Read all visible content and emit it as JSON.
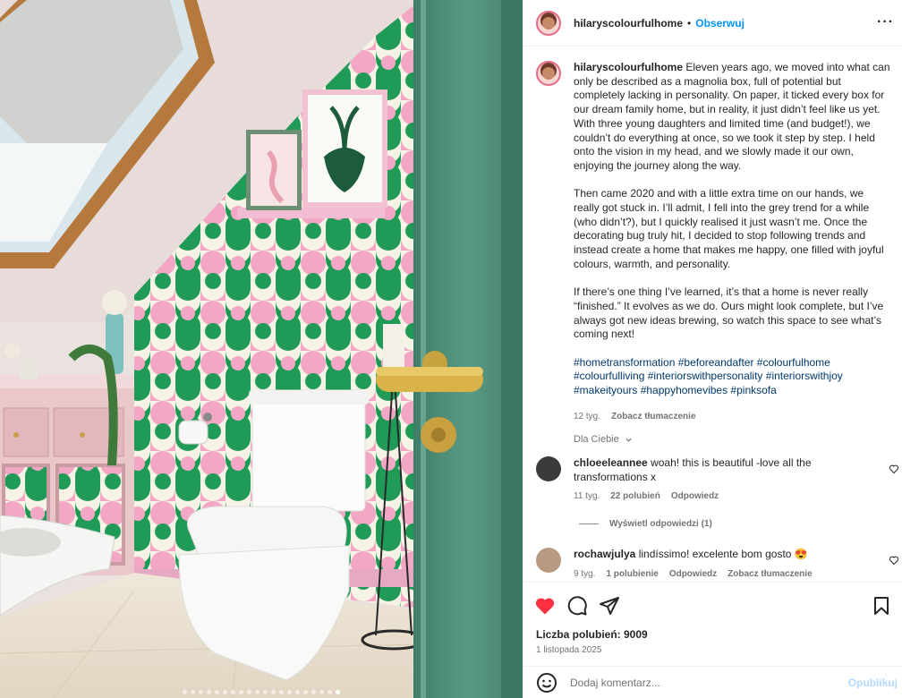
{
  "post": {
    "username": "hilaryscolourfulhome",
    "dot": "•",
    "follow_label": "Obserwuj",
    "more_label": "···"
  },
  "caption": {
    "username": "hilaryscolourfulhome",
    "paragraphs": [
      "Eleven years ago, we moved into what can only be described as a magnolia box, full of potential but completely lacking in personality. On paper, it ticked every box for our dream family home, but in reality, it just didn’t feel like us yet. With three young daughters and limited time (and budget!), we couldn’t do everything at once, so we took it step by step. I held onto the vision in my head, and we slowly made it our own, enjoying the journey along the way.",
      "Then came 2020 and with a little extra time on our hands, we really got stuck in. I’ll admit, I fell into the grey trend for a while (who didn’t?), but I quickly realised it just wasn’t me. Once the decorating bug truly hit, I decided to stop following trends and instead create a home that makes me happy, one filled with joyful colours, warmth, and personality.",
      "If there’s one thing I’ve learned, it’s that a home is never really “finished.” It evolves as we do. Ours might look complete, but I’ve always got new ideas brewing, so watch this space to see what’s coming next!"
    ],
    "hashtags": "#hometransformation #beforeandafter #colourfulhome #colourfulliving #interiorswithpersonality #interiorswithjoy #makeityours #happyhomevibes #pinksofa",
    "time": "12 tyg.",
    "translate_label": "Zobacz tłumaczenie"
  },
  "for_you_label": "Dla Ciebie",
  "comments": [
    {
      "username": "chloeeleannee",
      "text": "woah! this is beautiful -love all the transformations x",
      "time": "11 tyg.",
      "likes": "22 polubień",
      "reply_label": "Odpowiedz",
      "avatar_color": "#3b3b3b"
    },
    {
      "username": "rochawjulya",
      "text": "lindíssimo! excelente bom gosto 😍",
      "time": "9 tyg.",
      "likes": "1 polubienie",
      "reply_label": "Odpowiedz",
      "translate_label": "Zobacz tłumaczenie",
      "avatar_color": "#b89a82"
    }
  ],
  "view_replies_label": "Wyświetl odpowiedzi (1)",
  "actions": {
    "like_icon": "heart-filled-icon",
    "comment_icon": "speech-bubble-icon",
    "share_icon": "paper-plane-icon",
    "save_icon": "bookmark-icon",
    "like_color": "#ff3040"
  },
  "likes_text": "Liczba polubień: 9009",
  "date_text": "1 listopada 2025",
  "comment_box": {
    "placeholder": "Dodaj komentarz...",
    "publish_label": "Opublikuj"
  },
  "carousel": {
    "count": 20,
    "active_index": 19
  },
  "colors": {
    "accent_blue": "#0095f6",
    "wall_green": "#1f9a57",
    "wall_pink": "#f2a8c4",
    "door_green": "#4f8f7a"
  }
}
